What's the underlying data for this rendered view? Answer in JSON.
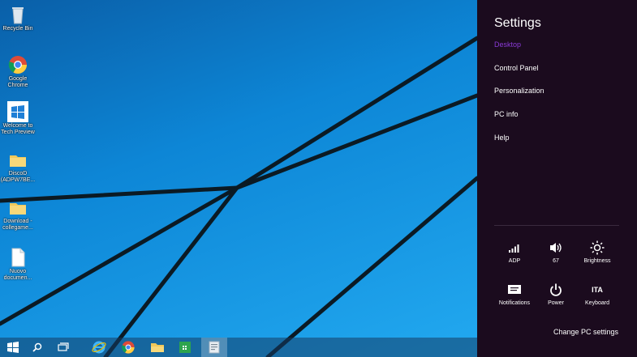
{
  "desktop": {
    "icons": [
      {
        "label": "Recycle Bin",
        "icon": "recycle-bin-icon"
      },
      {
        "label": "Google Chrome",
        "icon": "chrome-icon"
      },
      {
        "label": "Welcome to Tech Preview",
        "icon": "windows-logo-icon"
      },
      {
        "label": "DiscoD (ADPW7BE...",
        "icon": "folder-icon"
      },
      {
        "label": "Download - collegame...",
        "icon": "folder-icon"
      },
      {
        "label": "Nuovo documen...",
        "icon": "document-icon"
      }
    ]
  },
  "taskbar": {
    "items": [
      "start-button",
      "search-button",
      "task-view-button",
      "internet-explorer",
      "chrome",
      "file-explorer",
      "store",
      "active-window"
    ]
  },
  "settings_charm": {
    "title": "Settings",
    "links": [
      "Desktop",
      "Control Panel",
      "Personalization",
      "PC info",
      "Help"
    ],
    "quick_settings": [
      {
        "label": "ADP",
        "icon": "network-icon"
      },
      {
        "label": "67",
        "icon": "volume-icon"
      },
      {
        "label": "Brightness",
        "icon": "brightness-icon"
      },
      {
        "label": "Notifications",
        "icon": "notifications-icon"
      },
      {
        "label": "Power",
        "icon": "power-icon"
      },
      {
        "label": "Keyboard",
        "icon": "keyboard-icon",
        "glyph": "ITA"
      }
    ],
    "change_pc_settings": "Change PC settings"
  },
  "colors": {
    "charm_bg": "#1b0b1e",
    "desktop_accent": "#8a3ad6",
    "wallpaper_blue": "#0d86d6"
  }
}
